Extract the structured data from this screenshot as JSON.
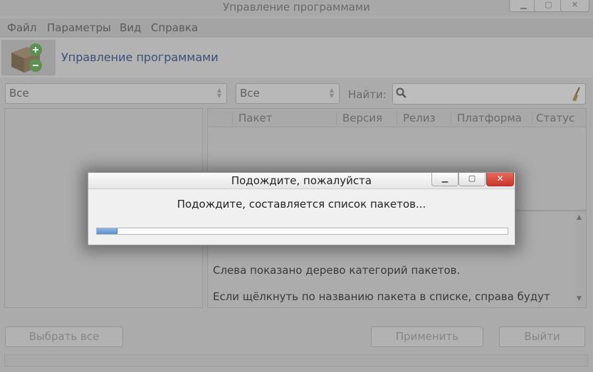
{
  "window": {
    "title": "Управление программами",
    "controls": {
      "minimize": "▁",
      "maximize": "▢",
      "close": "✕"
    }
  },
  "menu": [
    "Файл",
    "Параметры",
    "Вид",
    "Справка"
  ],
  "banner": {
    "title": "Управление программами",
    "logo_icon": "package-manager-icon"
  },
  "filters": {
    "category_value": "Все",
    "status_value": "Все",
    "search_label": "Найти:",
    "search_value": ""
  },
  "table": {
    "columns": [
      "Пакет",
      "Версия",
      "Релиз",
      "Платформа",
      "Статус"
    ]
  },
  "description": [
    "Слева показано дерево категорий пакетов.",
    "Если щёлкнуть по названию пакета в списке, справа будут"
  ],
  "buttons": {
    "select_all": "Выбрать все",
    "apply": "Применить",
    "exit": "Выйти"
  },
  "dialog": {
    "title": "Подождите, пожалуйста",
    "message": "Подождите, составляется список пакетов...",
    "progress": 0.05,
    "controls": {
      "minimize": "▁",
      "maximize": "▢",
      "close": "✕"
    }
  },
  "colors": {
    "accent_title": "#3d4f72",
    "progress_fill": "#5a8fcc",
    "close_button": "#c8362a"
  }
}
